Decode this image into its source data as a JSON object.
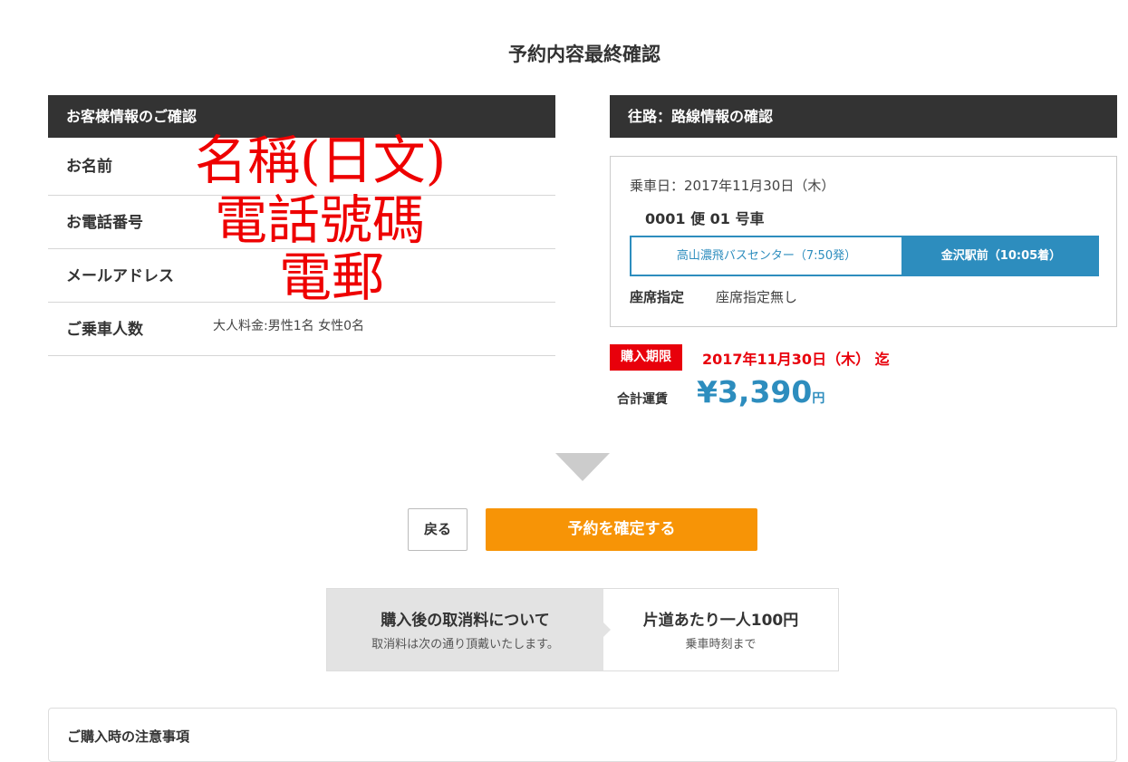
{
  "page": {
    "title": "予約内容最終確認"
  },
  "customer": {
    "header": "お客様情報のご確認",
    "rows": [
      {
        "label": "お名前",
        "value": ""
      },
      {
        "label": "お電話番号",
        "value": ""
      },
      {
        "label": "メールアドレス",
        "value": ""
      },
      {
        "label": "ご乗車人数",
        "value": "大人料金:男性1名  女性0名"
      }
    ],
    "overlay": {
      "name": "名稱(日文)",
      "phone": "電話號碼",
      "email": "電郵"
    }
  },
  "route": {
    "header": "往路：路線情報の確認",
    "ride_date": "乗車日：2017年11月30日（木）",
    "bus_number": "0001 便 01 号車",
    "from_stop": "高山濃飛バスセンター（7:50発）",
    "to_stop": "金沢駅前（10:05着）",
    "seat_label": "座席指定",
    "seat_value": "座席指定無し"
  },
  "purchase": {
    "deadline_tag": "購入期限",
    "deadline_date": "2017年11月30日（木） 迄",
    "total_label": "合計運賃",
    "total_amount": "¥3,390",
    "total_unit": "円"
  },
  "actions": {
    "back_label": "戻る",
    "confirm_label": "予約を確定する"
  },
  "cancellation": {
    "title": "購入後の取消料について",
    "subtitle": "取消料は次の通り頂戴いたします。",
    "fee_title": "片道あたり一人100円",
    "fee_subtitle": "乗車時刻まで"
  },
  "notes": {
    "title": "ご購入時の注意事項"
  },
  "colors": {
    "header_bg": "#333333",
    "accent_blue": "#2d8dbe",
    "deadline_red": "#e8000b",
    "confirm_orange": "#f79406",
    "overlay_red": "#ee0000"
  }
}
